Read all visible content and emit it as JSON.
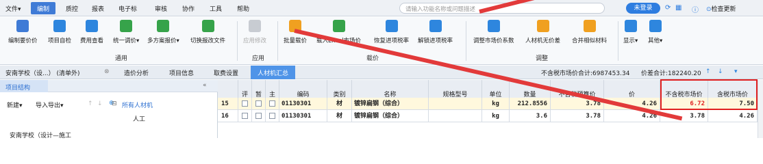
{
  "menu": {
    "items": [
      "文件▾",
      "编制",
      "质控",
      "报表",
      "电子标",
      "审核",
      "协作",
      "工具",
      "帮助"
    ],
    "search_placeholder": "请输入功能名称或问题描述",
    "login": "未登录",
    "check_update": "检查更新"
  },
  "toolbar": {
    "buttons": [
      "编制要价价",
      "项目自检",
      "费用查看",
      "统一调价▾",
      "多方案报价▾",
      "切换报改文件",
      "应用修改",
      "批量载价",
      "载入Excel市场价",
      "恢复进项税率",
      "解锁进项税率",
      "调整市场价系数",
      "人材机无价差",
      "合并相似材料",
      "显示▾",
      "其他▾"
    ],
    "groups": [
      "通用",
      "应用",
      "载价",
      "调整"
    ]
  },
  "tabs": {
    "project": "安南学校（设...） (清单外)",
    "items": [
      "造价分析",
      "项目信息",
      "取费设置",
      "人材机汇总"
    ]
  },
  "summary": {
    "market_total_label": "不含税市场价合计:6987453.34",
    "diff_total_label": "价差合计:182240.20"
  },
  "left_panel": {
    "tab": "项目结构",
    "new": "新建▾",
    "import_export": "导入导出▾",
    "tree_all": "所有人材机",
    "tree_labor": "人工",
    "tree_project": "安南学校（设计—施工"
  },
  "grid": {
    "columns": [
      "评",
      "暂",
      "主",
      "编码",
      "类别",
      "名称",
      "规格型号",
      "单位",
      "数量",
      "不含税预算价",
      "价",
      "不含税市场价",
      "含税市场价"
    ],
    "rows": [
      {
        "no": "15",
        "code": "01130301",
        "cat": "材",
        "name": "镀锌扁钢（综合）",
        "spec": "",
        "unit": "kg",
        "qty": "212.8556",
        "budget": "3.78",
        "c11": "4.26",
        "market": "6.72",
        "tax_market": "7.50"
      },
      {
        "no": "16",
        "code": "01130301",
        "cat": "材",
        "name": "镀锌扁钢（综合）",
        "spec": "",
        "unit": "kg",
        "qty": "3.6",
        "budget": "3.78",
        "c11": "4.26",
        "market": "3.78",
        "tax_market": "4.26"
      }
    ]
  },
  "colors": {
    "accent": "#3f7bd6",
    "highlight_red": "#e02020",
    "arrow_red": "#e23a3a"
  }
}
